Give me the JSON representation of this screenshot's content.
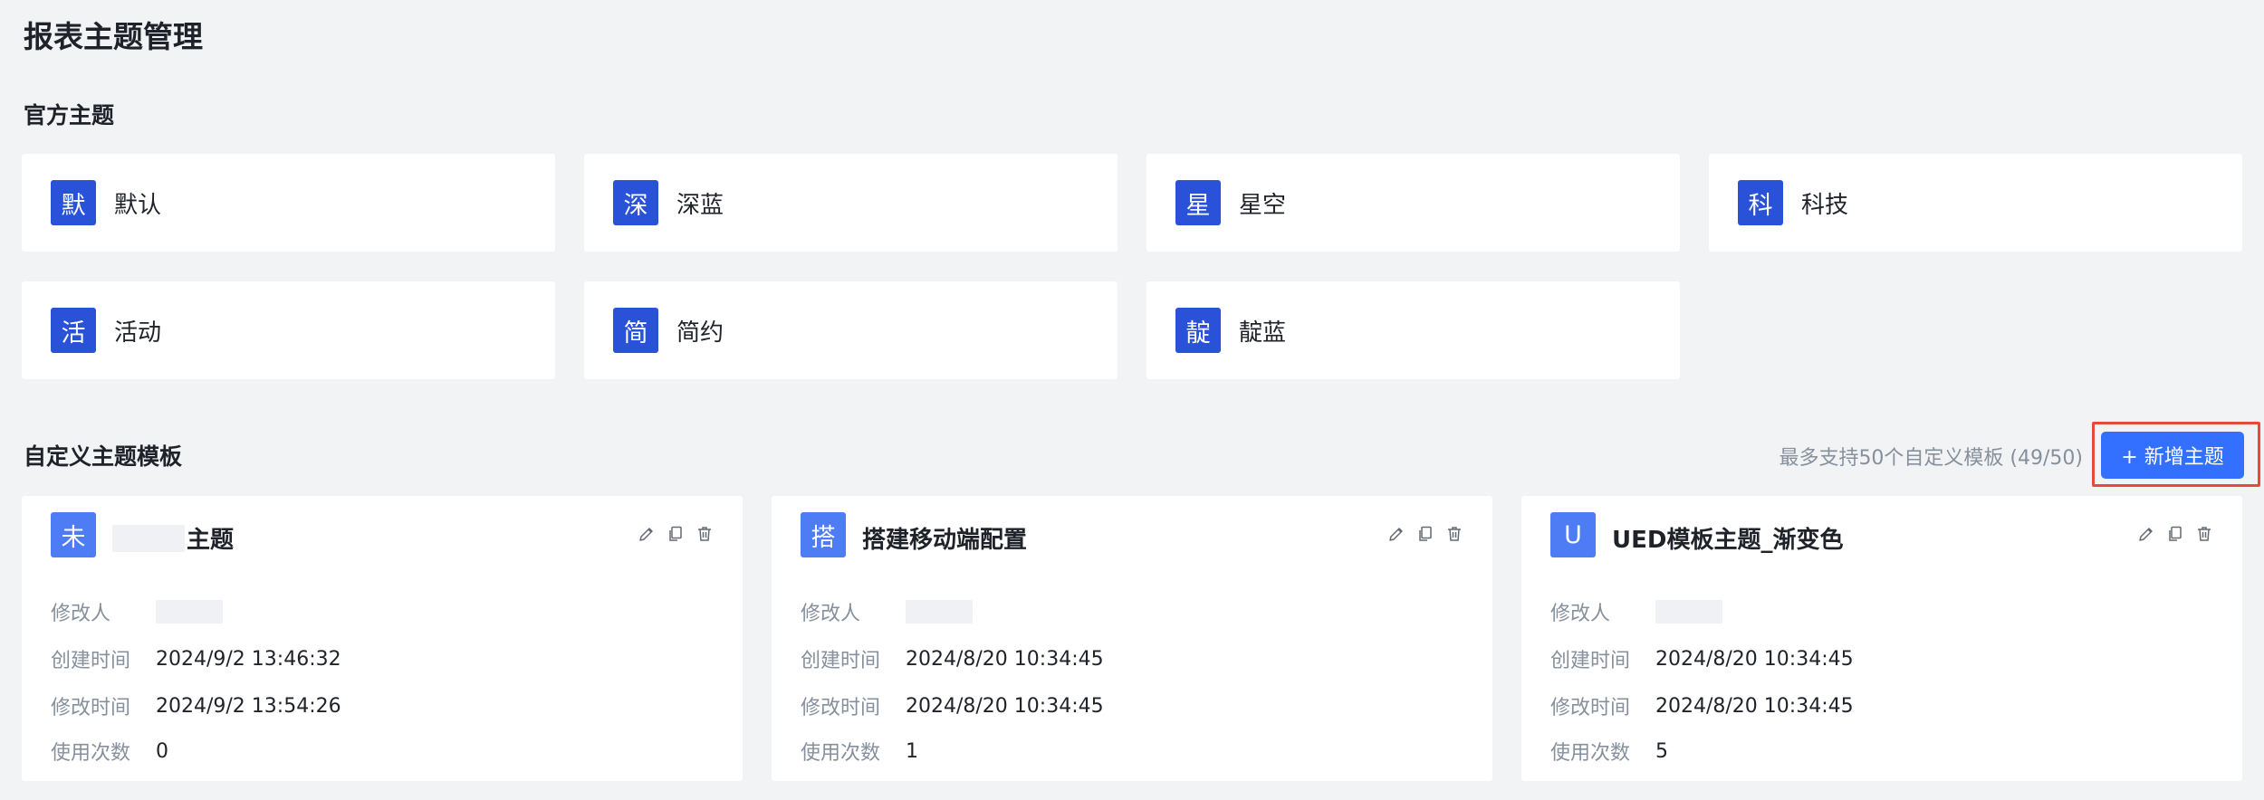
{
  "page": {
    "title": "报表主题管理"
  },
  "official": {
    "title": "官方主题",
    "themes": [
      {
        "badge": "默",
        "name": "默认"
      },
      {
        "badge": "深",
        "name": "深蓝"
      },
      {
        "badge": "星",
        "name": "星空"
      },
      {
        "badge": "科",
        "name": "科技"
      },
      {
        "badge": "活",
        "name": "活动"
      },
      {
        "badge": "简",
        "name": "简约"
      },
      {
        "badge": "靛",
        "name": "靛蓝"
      }
    ]
  },
  "custom": {
    "title": "自定义主题模板",
    "limit_text": "最多支持50个自定义模板 (49/50)",
    "add_button": "+ 新增主题",
    "labels": {
      "modifier": "修改人",
      "created": "创建时间",
      "modified": "修改时间",
      "usage": "使用次数"
    },
    "templates": [
      {
        "badge": "未",
        "name": "主题",
        "created": "2024/9/2 13:46:32",
        "modified": "2024/9/2 13:54:26",
        "usage": "0"
      },
      {
        "badge": "搭",
        "name": "搭建移动端配置",
        "created": "2024/8/20 10:34:45",
        "modified": "2024/8/20 10:34:45",
        "usage": "1"
      },
      {
        "badge": "U",
        "name": "UED模板主题_渐变色",
        "created": "2024/8/20 10:34:45",
        "modified": "2024/8/20 10:34:45",
        "usage": "5"
      }
    ]
  },
  "icons": [
    "edit-icon",
    "copy-icon",
    "delete-icon"
  ],
  "colors": {
    "badge_official": "#2952d9",
    "badge_custom": "#4d7cf5",
    "primary_button": "#3370ff",
    "highlight_border": "#e64a3b",
    "background": "#f2f3f5"
  }
}
